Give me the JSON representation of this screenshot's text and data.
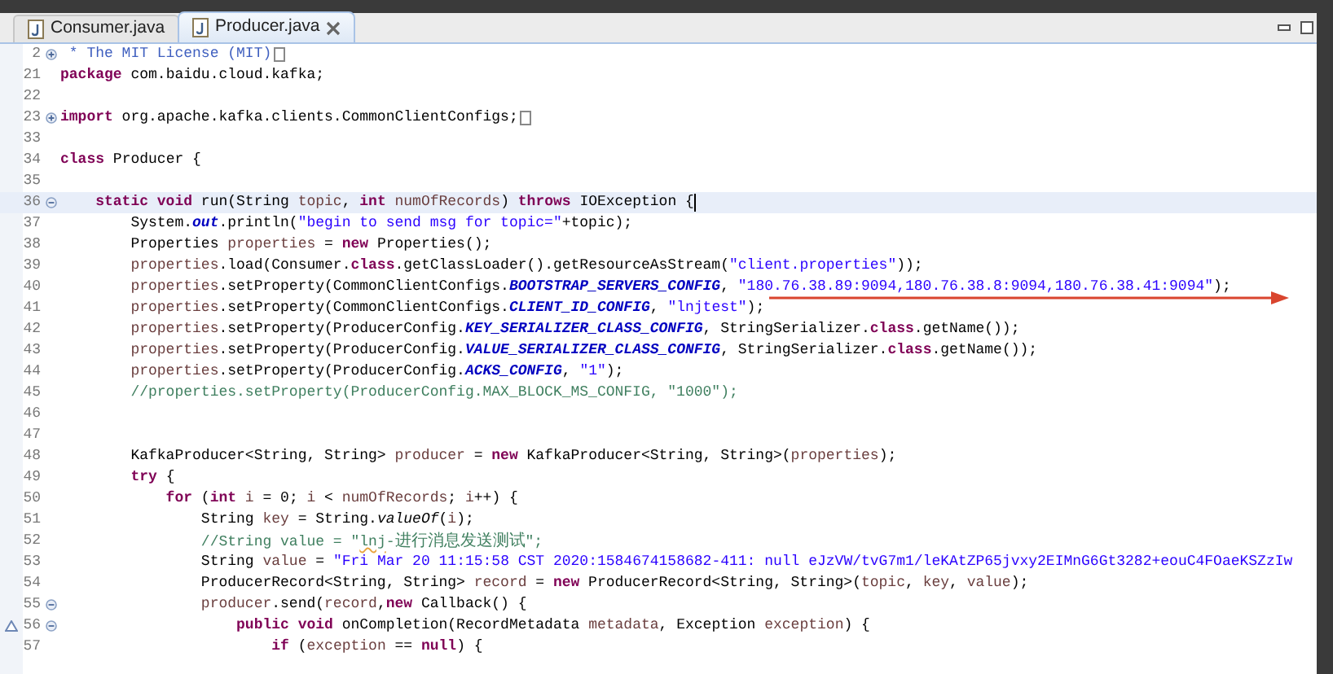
{
  "tabs": [
    {
      "label": "Consumer.java",
      "selected": false,
      "closable": false
    },
    {
      "label": "Producer.java",
      "selected": true,
      "closable": true
    }
  ],
  "lines": [
    {
      "number": "2",
      "expanded": false,
      "tokens": [
        {
          "kind": "doc",
          "text": " * The MIT License (MIT)"
        }
      ]
    },
    {
      "number": "21",
      "tokens": [
        {
          "kind": "kw",
          "text": "package"
        },
        {
          "kind": "p",
          "text": " com.baidu.cloud.kafka;"
        }
      ]
    },
    {
      "number": "22"
    },
    {
      "number": "23",
      "expanded": false,
      "tokens": [
        {
          "kind": "kw",
          "text": "import"
        },
        {
          "kind": "p",
          "text": " org.apache.kafka.clients.CommonClientConfigs;"
        }
      ]
    },
    {
      "number": "33"
    },
    {
      "number": "34",
      "tokens": [
        {
          "kind": "kw",
          "text": "class"
        },
        {
          "kind": "p",
          "text": " Producer {"
        }
      ]
    },
    {
      "number": "35"
    },
    {
      "number": "36",
      "expanded": true,
      "current": true,
      "tokens": [
        {
          "kind": "kw",
          "text": "    static void"
        },
        {
          "kind": "p",
          "text": " run(String "
        },
        {
          "kind": "var",
          "text": "topic"
        },
        {
          "kind": "p",
          "text": ", "
        },
        {
          "kind": "kw",
          "text": "int"
        },
        {
          "kind": "var",
          "text": " numOfRecords"
        },
        {
          "kind": "p",
          "text": ") "
        },
        {
          "kind": "kw",
          "text": "throws"
        },
        {
          "kind": "p",
          "text": " IOException {"
        }
      ]
    },
    {
      "number": "37",
      "tokens": [
        {
          "kind": "p",
          "text": "        System."
        },
        {
          "kind": "sf",
          "text": "out"
        },
        {
          "kind": "p",
          "text": ".println("
        },
        {
          "kind": "str",
          "text": "\"begin to send msg for topic=\""
        },
        {
          "kind": "p",
          "text": "+topic);"
        }
      ]
    },
    {
      "number": "38",
      "tokens": [
        {
          "kind": "p",
          "text": "        Properties "
        },
        {
          "kind": "var",
          "text": "properties"
        },
        {
          "kind": "p",
          "text": " = "
        },
        {
          "kind": "kw",
          "text": "new"
        },
        {
          "kind": "p",
          "text": " Properties();"
        }
      ]
    },
    {
      "number": "39",
      "tokens": [
        {
          "kind": "var",
          "text": "        properties"
        },
        {
          "kind": "p",
          "text": ".load(Consumer."
        },
        {
          "kind": "kw",
          "text": "class"
        },
        {
          "kind": "p",
          "text": ".getClassLoader().getResourceAsStream("
        },
        {
          "kind": "str",
          "text": "\"client.properties\""
        },
        {
          "kind": "p",
          "text": "));"
        }
      ]
    },
    {
      "number": "40",
      "tokens": [
        {
          "kind": "var",
          "text": "        properties"
        },
        {
          "kind": "p",
          "text": ".setProperty(CommonClientConfigs."
        },
        {
          "kind": "sf",
          "text": "BOOTSTRAP_SERVERS_CONFIG"
        },
        {
          "kind": "p",
          "text": ", "
        },
        {
          "kind": "str",
          "text": "\"180.76.38.89:9094,180.76.38.8:9094,180.76.38.41:9094\""
        },
        {
          "kind": "p",
          "text": ");"
        }
      ]
    },
    {
      "number": "41",
      "tokens": [
        {
          "kind": "var",
          "text": "        properties"
        },
        {
          "kind": "p",
          "text": ".setProperty(CommonClientConfigs."
        },
        {
          "kind": "sf",
          "text": "CLIENT_ID_CONFIG"
        },
        {
          "kind": "p",
          "text": ", "
        },
        {
          "kind": "str",
          "text": "\"lnjtest\""
        },
        {
          "kind": "p",
          "text": ");"
        }
      ]
    },
    {
      "number": "42",
      "tokens": [
        {
          "kind": "var",
          "text": "        properties"
        },
        {
          "kind": "p",
          "text": ".setProperty(ProducerConfig."
        },
        {
          "kind": "sf",
          "text": "KEY_SERIALIZER_CLASS_CONFIG"
        },
        {
          "kind": "p",
          "text": ", StringSerializer."
        },
        {
          "kind": "kw",
          "text": "class"
        },
        {
          "kind": "p",
          "text": ".getName());"
        }
      ]
    },
    {
      "number": "43",
      "tokens": [
        {
          "kind": "var",
          "text": "        properties"
        },
        {
          "kind": "p",
          "text": ".setProperty(ProducerConfig."
        },
        {
          "kind": "sf",
          "text": "VALUE_SERIALIZER_CLASS_CONFIG"
        },
        {
          "kind": "p",
          "text": ", StringSerializer."
        },
        {
          "kind": "kw",
          "text": "class"
        },
        {
          "kind": "p",
          "text": ".getName());"
        }
      ]
    },
    {
      "number": "44",
      "tokens": [
        {
          "kind": "var",
          "text": "        properties"
        },
        {
          "kind": "p",
          "text": ".setProperty(ProducerConfig."
        },
        {
          "kind": "sf",
          "text": "ACKS_CONFIG"
        },
        {
          "kind": "p",
          "text": ", "
        },
        {
          "kind": "str",
          "text": "\"1\""
        },
        {
          "kind": "p",
          "text": ");"
        }
      ]
    },
    {
      "number": "45",
      "tokens": [
        {
          "kind": "cm",
          "text": "        //properties.setProperty(ProducerConfig.MAX_BLOCK_MS_CONFIG, \"1000\");"
        }
      ]
    },
    {
      "number": "46"
    },
    {
      "number": "47"
    },
    {
      "number": "48",
      "tokens": [
        {
          "kind": "p",
          "text": "        KafkaProducer<String, String> "
        },
        {
          "kind": "var",
          "text": "producer"
        },
        {
          "kind": "p",
          "text": " = "
        },
        {
          "kind": "kw",
          "text": "new"
        },
        {
          "kind": "p",
          "text": " KafkaProducer<String, String>("
        },
        {
          "kind": "var",
          "text": "properties"
        },
        {
          "kind": "p",
          "text": ");"
        }
      ]
    },
    {
      "number": "49",
      "tokens": [
        {
          "kind": "kw",
          "text": "        try"
        },
        {
          "kind": "p",
          "text": " {"
        }
      ]
    },
    {
      "number": "50",
      "tokens": [
        {
          "kind": "kw",
          "text": "            for"
        },
        {
          "kind": "p",
          "text": " ("
        },
        {
          "kind": "kw",
          "text": "int"
        },
        {
          "kind": "var",
          "text": " i"
        },
        {
          "kind": "p",
          "text": " = 0; "
        },
        {
          "kind": "var",
          "text": "i"
        },
        {
          "kind": "p",
          "text": " < "
        },
        {
          "kind": "var",
          "text": "numOfRecords"
        },
        {
          "kind": "p",
          "text": "; "
        },
        {
          "kind": "var",
          "text": "i"
        },
        {
          "kind": "p",
          "text": "++) {"
        }
      ]
    },
    {
      "number": "51",
      "tokens": [
        {
          "kind": "p",
          "text": "                String "
        },
        {
          "kind": "var",
          "text": "key"
        },
        {
          "kind": "p",
          "text": " = String."
        },
        {
          "kind": "si",
          "text": "valueOf"
        },
        {
          "kind": "p",
          "text": "("
        },
        {
          "kind": "var",
          "text": "i"
        },
        {
          "kind": "p",
          "text": ");"
        }
      ]
    },
    {
      "number": "52",
      "tokens": [
        {
          "kind": "cm",
          "text": "                //String value = \""
        },
        {
          "kind": "spell",
          "text": "lnj"
        },
        {
          "kind": "cm",
          "text": "-"
        },
        {
          "kind": "cjk",
          "text": "进行消息发送测试"
        },
        {
          "kind": "cm",
          "text": "\";"
        }
      ]
    },
    {
      "number": "53",
      "tokens": [
        {
          "kind": "p",
          "text": "                String "
        },
        {
          "kind": "var",
          "text": "value"
        },
        {
          "kind": "p",
          "text": " = "
        },
        {
          "kind": "str",
          "text": "\"Fri Mar 20 11:15:58 CST 2020:1584674158682-411: null eJzVW/tvG7m1/leKAtZP65jvxy2EIMnG6Gt3282+eouC4FOaeKSZzIw"
        }
      ]
    },
    {
      "number": "54",
      "tokens": [
        {
          "kind": "p",
          "text": "                ProducerRecord<String, String> "
        },
        {
          "kind": "var",
          "text": "record"
        },
        {
          "kind": "p",
          "text": " = "
        },
        {
          "kind": "kw",
          "text": "new"
        },
        {
          "kind": "p",
          "text": " ProducerRecord<String, String>("
        },
        {
          "kind": "var",
          "text": "topic"
        },
        {
          "kind": "p",
          "text": ", "
        },
        {
          "kind": "var",
          "text": "key"
        },
        {
          "kind": "p",
          "text": ", "
        },
        {
          "kind": "var",
          "text": "value"
        },
        {
          "kind": "p",
          "text": ");"
        }
      ]
    },
    {
      "number": "55",
      "expanded": true,
      "tokens": [
        {
          "kind": "var",
          "text": "                producer"
        },
        {
          "kind": "p",
          "text": ".send("
        },
        {
          "kind": "var",
          "text": "record"
        },
        {
          "kind": "p",
          "text": ","
        },
        {
          "kind": "kw",
          "text": "new"
        },
        {
          "kind": "p",
          "text": " Callback() {"
        }
      ]
    },
    {
      "number": "56",
      "expanded": true,
      "override": true,
      "tokens": [
        {
          "kind": "kw",
          "text": "                    public void"
        },
        {
          "kind": "p",
          "text": " onCompletion(RecordMetadata "
        },
        {
          "kind": "var",
          "text": "metadata"
        },
        {
          "kind": "p",
          "text": ", Exception "
        },
        {
          "kind": "var",
          "text": "exception"
        },
        {
          "kind": "p",
          "text": ") {"
        }
      ]
    },
    {
      "number": "57",
      "tokens": [
        {
          "kind": "kw",
          "text": "                        if"
        },
        {
          "kind": "p",
          "text": " ("
        },
        {
          "kind": "var",
          "text": "exception"
        },
        {
          "kind": "p",
          "text": " == "
        },
        {
          "kind": "kw",
          "text": "null"
        },
        {
          "kind": "p",
          "text": ") {"
        }
      ]
    }
  ]
}
